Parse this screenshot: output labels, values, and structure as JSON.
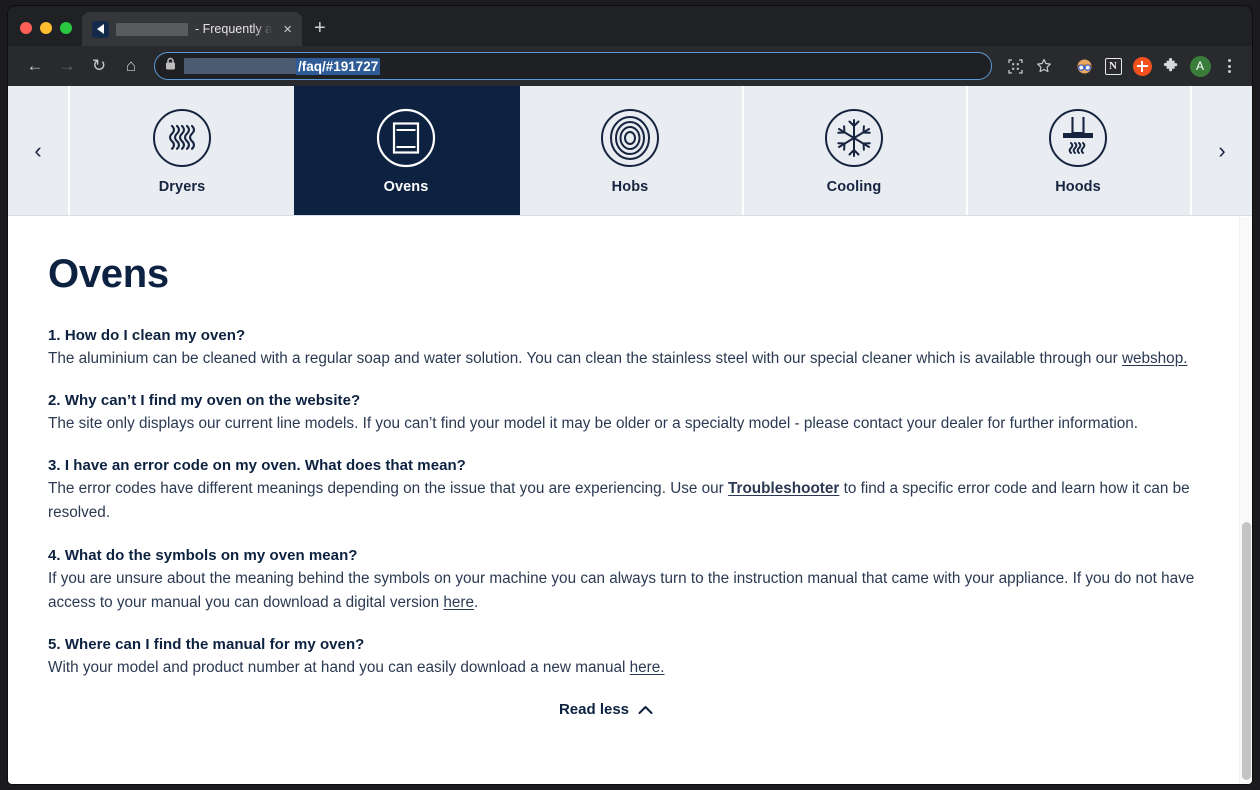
{
  "browser": {
    "tab": {
      "title_suffix": "- Frequently ask",
      "close_label": "×",
      "favicon_name": "site-favicon"
    },
    "new_tab_label": "+",
    "nav": {
      "back": "←",
      "forward": "→",
      "reload": "↻",
      "home": "⌂"
    },
    "omnibox": {
      "url_visible": "/faq/#191727",
      "lock_icon": "lock-icon"
    },
    "toolbar_icons": [
      {
        "name": "qr-code-icon",
        "glyph": "⌗"
      },
      {
        "name": "bookmark-star-icon",
        "glyph": "☆"
      },
      {
        "name": "glasses-avatar-extension-icon",
        "glyph": "🤓"
      },
      {
        "name": "notion-extension-icon",
        "glyph": "N"
      },
      {
        "name": "orange-plus-extension-icon",
        "glyph": "+"
      },
      {
        "name": "extensions-puzzle-icon",
        "glyph": "❖"
      },
      {
        "name": "profile-avatar",
        "glyph": "A"
      },
      {
        "name": "chrome-menu-icon",
        "glyph": "⋮"
      }
    ]
  },
  "carousel": {
    "prev_label": "‹",
    "next_label": "›",
    "items": [
      {
        "label": "Dryers",
        "icon": "dryer-icon",
        "active": false
      },
      {
        "label": "Ovens",
        "icon": "oven-icon",
        "active": true
      },
      {
        "label": "Hobs",
        "icon": "hob-icon",
        "active": false
      },
      {
        "label": "Cooling",
        "icon": "snowflake-icon",
        "active": false
      },
      {
        "label": "Hoods",
        "icon": "hood-icon",
        "active": false
      }
    ]
  },
  "page": {
    "title": "Ovens",
    "faqs": [
      {
        "question": "1. How do I clean my oven?",
        "answer_pre": "The aluminium can be cleaned with a regular soap and water solution. You can clean the stainless steel with our special cleaner which is available through our ",
        "link": "webshop.",
        "answer_post": ""
      },
      {
        "question": "2. Why can’t I find my oven on the website?",
        "answer_pre": "The site only displays our current line models. If you can’t find your model it may be older or a specialty model - please contact your dealer for further information.",
        "link": "",
        "answer_post": ""
      },
      {
        "question": "3. I have an error code on my oven. What does that mean?",
        "answer_pre": "The error codes have different meanings depending on the issue that you are experiencing. Use our ",
        "link": "Troubleshooter",
        "answer_post": " to find a specific error code and learn how it can be resolved."
      },
      {
        "question": "4. What do the symbols on my oven mean?",
        "answer_pre": "If you are unsure about the meaning behind the symbols on your machine you can always turn to the instruction manual that came with your appliance. If you do not have access to your manual you can download a digital version ",
        "link": "here",
        "answer_post": "."
      },
      {
        "question": "5. Where can I find the manual for my oven?",
        "answer_pre": "With your model and product number at hand you can easily download a new manual ",
        "link": "here.",
        "answer_post": ""
      }
    ],
    "read_less": {
      "label": "Read less",
      "chevron": "ⱏ"
    }
  },
  "colors": {
    "brand_navy": "#0d2240",
    "carousel_bg": "#e9ecf1",
    "body_text": "#2b3a52"
  }
}
